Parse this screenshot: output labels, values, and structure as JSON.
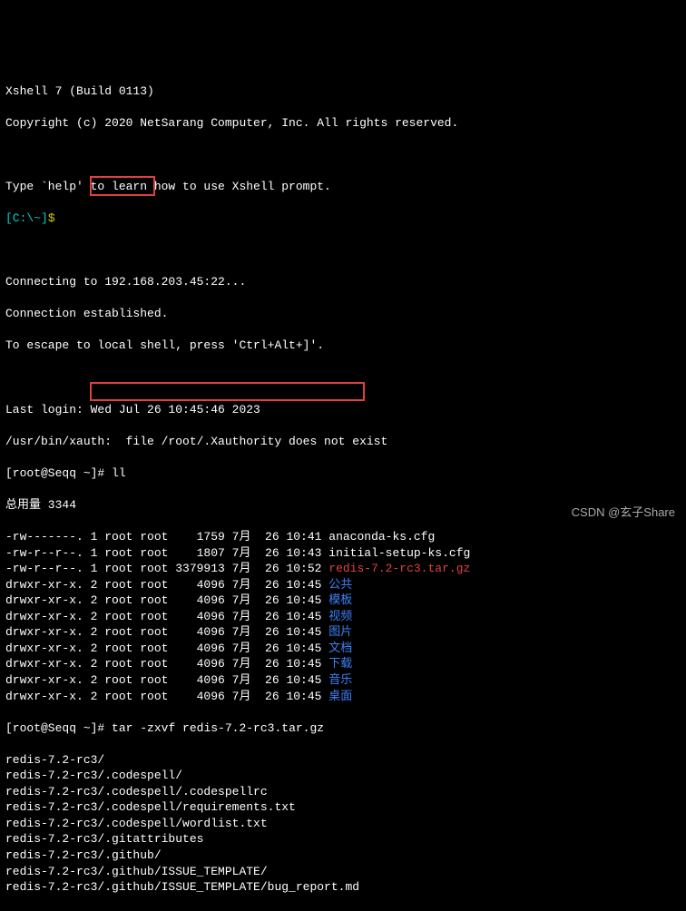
{
  "header": {
    "title": "Xshell 7 (Build 0113)",
    "copyright": "Copyright (c) 2020 NetSarang Computer, Inc. All rights reserved."
  },
  "intro": {
    "help": "Type `help' to learn how to use Xshell prompt.",
    "prompt_prefix": "[C:\\~]",
    "prompt_suffix": "$"
  },
  "connection": {
    "connecting": "Connecting to 192.168.203.45:22...",
    "established": "Connection established.",
    "escape": "To escape to local shell, press 'Ctrl+Alt+]'."
  },
  "session": {
    "last_login": "Last login: Wed Jul 26 10:45:46 2023",
    "xauth": "/usr/bin/xauth:  file /root/.Xauthority does not exist",
    "prompt1_prefix": "[root@Seqq ~]",
    "prompt1_hash": "# ",
    "cmd1": "ll"
  },
  "ls": {
    "total": "总用量 3344",
    "rows": [
      {
        "perm": "-rw-------.",
        "n": "1",
        "own": "root",
        "grp": "root",
        "size": "    1759",
        "mon": "7月",
        "day": "  26",
        "time": "10:41",
        "name": "anaconda-ks.cfg",
        "cls": ""
      },
      {
        "perm": "-rw-r--r--.",
        "n": "1",
        "own": "root",
        "grp": "root",
        "size": "    1807",
        "mon": "7月",
        "day": "  26",
        "time": "10:43",
        "name": "initial-setup-ks.cfg",
        "cls": ""
      },
      {
        "perm": "-rw-r--r--.",
        "n": "1",
        "own": "root",
        "grp": "root",
        "size": " 3379913",
        "mon": "7月",
        "day": "  26",
        "time": "10:52",
        "name": "redis-7.2-rc3.tar.gz",
        "cls": "red"
      },
      {
        "perm": "drwxr-xr-x.",
        "n": "2",
        "own": "root",
        "grp": "root",
        "size": "    4096",
        "mon": "7月",
        "day": "  26",
        "time": "10:45",
        "name": "公共",
        "cls": "blue"
      },
      {
        "perm": "drwxr-xr-x.",
        "n": "2",
        "own": "root",
        "grp": "root",
        "size": "    4096",
        "mon": "7月",
        "day": "  26",
        "time": "10:45",
        "name": "模板",
        "cls": "blue"
      },
      {
        "perm": "drwxr-xr-x.",
        "n": "2",
        "own": "root",
        "grp": "root",
        "size": "    4096",
        "mon": "7月",
        "day": "  26",
        "time": "10:45",
        "name": "视频",
        "cls": "blue"
      },
      {
        "perm": "drwxr-xr-x.",
        "n": "2",
        "own": "root",
        "grp": "root",
        "size": "    4096",
        "mon": "7月",
        "day": "  26",
        "time": "10:45",
        "name": "图片",
        "cls": "blue"
      },
      {
        "perm": "drwxr-xr-x.",
        "n": "2",
        "own": "root",
        "grp": "root",
        "size": "    4096",
        "mon": "7月",
        "day": "  26",
        "time": "10:45",
        "name": "文档",
        "cls": "blue"
      },
      {
        "perm": "drwxr-xr-x.",
        "n": "2",
        "own": "root",
        "grp": "root",
        "size": "    4096",
        "mon": "7月",
        "day": "  26",
        "time": "10:45",
        "name": "下载",
        "cls": "blue"
      },
      {
        "perm": "drwxr-xr-x.",
        "n": "2",
        "own": "root",
        "grp": "root",
        "size": "    4096",
        "mon": "7月",
        "day": "  26",
        "time": "10:45",
        "name": "音乐",
        "cls": "blue"
      },
      {
        "perm": "drwxr-xr-x.",
        "n": "2",
        "own": "root",
        "grp": "root",
        "size": "    4096",
        "mon": "7月",
        "day": "  26",
        "time": "10:45",
        "name": "桌面",
        "cls": "blue"
      }
    ]
  },
  "cmd2": {
    "prompt_prefix": "[root@Seqq ~]",
    "prompt_hash": "# ",
    "cmd": "tar -zxvf redis-7.2-rc3.tar.gz"
  },
  "tar_output": [
    "redis-7.2-rc3/",
    "redis-7.2-rc3/.codespell/",
    "redis-7.2-rc3/.codespell/.codespellrc",
    "redis-7.2-rc3/.codespell/requirements.txt",
    "redis-7.2-rc3/.codespell/wordlist.txt",
    "redis-7.2-rc3/.gitattributes",
    "redis-7.2-rc3/.github/",
    "redis-7.2-rc3/.github/ISSUE_TEMPLATE/",
    "redis-7.2-rc3/.github/ISSUE_TEMPLATE/bug_report.md"
  ],
  "watermark": "CSDN @玄子Share"
}
